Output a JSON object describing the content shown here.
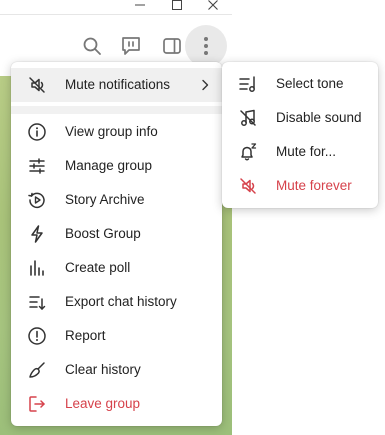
{
  "window": {
    "minimize_icon": "minimize-icon",
    "maximize_icon": "maximize-icon",
    "close_icon": "close-icon"
  },
  "header": {
    "icons": [
      "search-icon",
      "live-stream-icon",
      "sidebar-toggle-icon",
      "more-vertical-icon"
    ]
  },
  "colors": {
    "danger": "#d6424b",
    "chat_background": "#a9c37a",
    "highlight": "#f0f0f0"
  },
  "menu": {
    "mute": {
      "label": "Mute notifications",
      "icon": "bell-off-icon"
    },
    "items": [
      {
        "label": "View group info",
        "icon": "info-icon"
      },
      {
        "label": "Manage group",
        "icon": "sliders-icon"
      },
      {
        "label": "Story Archive",
        "icon": "archive-history-icon"
      },
      {
        "label": "Boost Group",
        "icon": "lightning-icon"
      },
      {
        "label": "Create poll",
        "icon": "poll-icon"
      },
      {
        "label": "Export chat history",
        "icon": "export-icon"
      },
      {
        "label": "Report",
        "icon": "report-icon"
      },
      {
        "label": "Clear history",
        "icon": "broom-icon"
      },
      {
        "label": "Leave group",
        "icon": "leave-icon"
      }
    ]
  },
  "submenu": {
    "items": [
      {
        "label": "Select tone",
        "icon": "music-list-icon"
      },
      {
        "label": "Disable sound",
        "icon": "note-off-icon"
      },
      {
        "label": "Mute for...",
        "icon": "bell-sleep-icon"
      },
      {
        "label": "Mute forever",
        "icon": "bell-off-icon"
      }
    ]
  }
}
